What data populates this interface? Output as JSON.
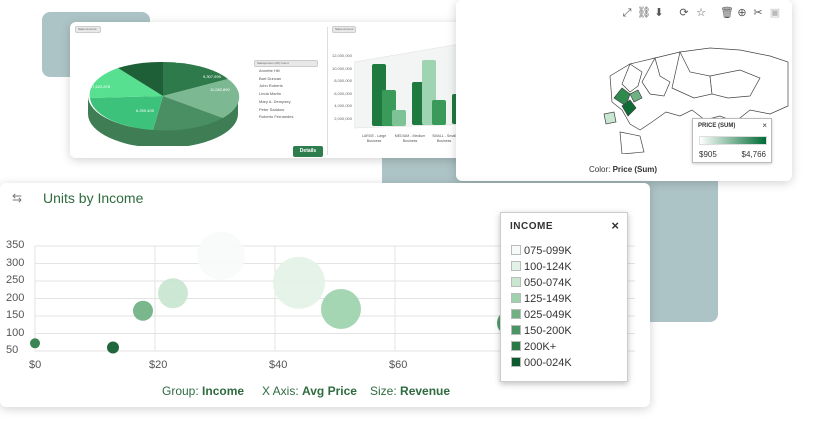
{
  "top_card": {
    "chip_pie": "Sales Amount",
    "chip_legend": "Salesperson (All) Count",
    "chip_bar": "Sales Amount",
    "details_label": "Details",
    "pie_labels": [
      "10,723,989",
      "9,307,995",
      "17,622,878",
      "6,259,405",
      "11,082,890"
    ],
    "pie_legend": [
      "Annette Hill",
      "Bart Duncan",
      "John Roberts",
      "Linda Martin",
      "Mary A. Dempsey",
      "Peter Saddow",
      "Roberto Fernandes"
    ],
    "bar_yticks": [
      "12,000,000",
      "10,000,000",
      "8,000,000",
      "6,000,000",
      "4,000,000",
      "2,000,000"
    ],
    "bar_categories": [
      "LARGE - Large Business",
      "MEDIUM - Medium Business",
      "SMALL - Small Business"
    ],
    "bar_legend": [
      "SPORTS - Sports & Activities",
      "EVENTS - Events and Tradeshows",
      "CORPORATE - Corporate Gifts and Awards"
    ]
  },
  "map_card": {
    "legend_title": "PRICE (SUM)",
    "legend_close": "×",
    "legend_min": "$905",
    "legend_max": "$4,766",
    "color_label": "Color:",
    "color_value": "Price (Sum)",
    "tool_icons": [
      "expand-icon",
      "link-icon",
      "download-icon",
      "refresh-icon",
      "star-icon",
      "trash-icon",
      "add-icon",
      "tools-icon",
      "save-icon"
    ]
  },
  "main_card": {
    "title": "Units by Income",
    "y_ticks": [
      "350",
      "300",
      "250",
      "200",
      "150",
      "100",
      "50"
    ],
    "x_ticks": [
      "$0",
      "$20",
      "$40",
      "$60",
      "$80"
    ],
    "footer": {
      "group_label": "Group:",
      "group_value": "Income",
      "x_label": "X Axis:",
      "x_value": "Avg Price",
      "size_label": "Size:",
      "size_value": "Revenue"
    }
  },
  "income_legend": {
    "title": "INCOME",
    "close": "×",
    "items": [
      {
        "label": "075-099K",
        "color": "#f7fbf8"
      },
      {
        "label": "100-124K",
        "color": "#e3f2e7"
      },
      {
        "label": "050-074K",
        "color": "#c8e6d0"
      },
      {
        "label": "125-149K",
        "color": "#9dd2ac"
      },
      {
        "label": "025-049K",
        "color": "#6fb182"
      },
      {
        "label": "150-200K",
        "color": "#4a9466"
      },
      {
        "label": "200K+",
        "color": "#2a7a48"
      },
      {
        "label": "000-024K",
        "color": "#0d5a2e"
      }
    ]
  },
  "chart_data": {
    "type": "scatter",
    "title": "Units by Income",
    "xlabel": "Avg Price",
    "ylabel": "",
    "xlim": [
      0,
      100
    ],
    "ylim": [
      0,
      370
    ],
    "x_ticks": [
      0,
      20,
      40,
      60,
      80
    ],
    "y_ticks": [
      50,
      100,
      150,
      200,
      250,
      300,
      350
    ],
    "grid": true,
    "legend_position": "right",
    "series": [
      {
        "name": "000-024K",
        "color": "#0d5a2e",
        "points": [
          {
            "x": 13,
            "y": 60,
            "size": 6
          }
        ]
      },
      {
        "name": "200K+",
        "color": "#2a7a48",
        "points": [
          {
            "x": 0,
            "y": 72,
            "size": 5
          }
        ]
      },
      {
        "name": "150-200K",
        "color": "#4a9466",
        "points": [
          {
            "x": 79,
            "y": 130,
            "size": 12
          }
        ]
      },
      {
        "name": "025-049K",
        "color": "#6fb182",
        "points": [
          {
            "x": 18,
            "y": 165,
            "size": 10
          }
        ]
      },
      {
        "name": "125-149K",
        "color": "#9dd2ac",
        "points": [
          {
            "x": 51,
            "y": 170,
            "size": 20
          }
        ]
      },
      {
        "name": "050-074K",
        "color": "#c8e6d0",
        "points": [
          {
            "x": 23,
            "y": 215,
            "size": 15
          }
        ]
      },
      {
        "name": "100-124K",
        "color": "#e3f2e7",
        "points": [
          {
            "x": 44,
            "y": 245,
            "size": 26
          }
        ]
      },
      {
        "name": "075-099K",
        "color": "#f7fbf8",
        "points": [
          {
            "x": 31,
            "y": 322,
            "size": 24
          }
        ]
      }
    ]
  }
}
